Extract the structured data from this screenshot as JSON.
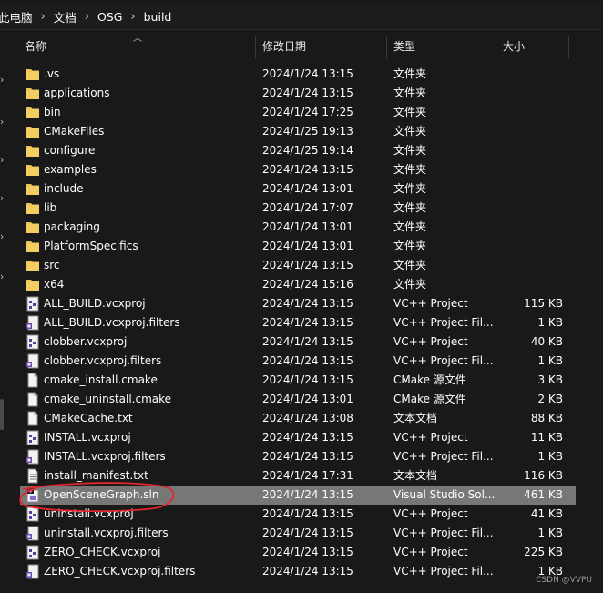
{
  "breadcrumb": {
    "items": [
      "此电脑",
      "文档",
      "OSG",
      "build"
    ],
    "separator": "›"
  },
  "columns": {
    "name": "名称",
    "date": "修改日期",
    "type": "类型",
    "size": "大小"
  },
  "rows": [
    {
      "icon": "folder-icon",
      "name": ".vs",
      "date": "2024/1/24 13:15",
      "type": "文件夹",
      "size": ""
    },
    {
      "icon": "folder-icon",
      "name": "applications",
      "date": "2024/1/24 13:15",
      "type": "文件夹",
      "size": ""
    },
    {
      "icon": "folder-icon",
      "name": "bin",
      "date": "2024/1/24 17:25",
      "type": "文件夹",
      "size": ""
    },
    {
      "icon": "folder-icon",
      "name": "CMakeFiles",
      "date": "2024/1/25 19:13",
      "type": "文件夹",
      "size": ""
    },
    {
      "icon": "folder-icon",
      "name": "configure",
      "date": "2024/1/25 19:14",
      "type": "文件夹",
      "size": ""
    },
    {
      "icon": "folder-icon",
      "name": "examples",
      "date": "2024/1/24 13:15",
      "type": "文件夹",
      "size": ""
    },
    {
      "icon": "folder-icon",
      "name": "include",
      "date": "2024/1/24 13:01",
      "type": "文件夹",
      "size": ""
    },
    {
      "icon": "folder-icon",
      "name": "lib",
      "date": "2024/1/24 17:07",
      "type": "文件夹",
      "size": ""
    },
    {
      "icon": "folder-icon",
      "name": "packaging",
      "date": "2024/1/24 13:01",
      "type": "文件夹",
      "size": ""
    },
    {
      "icon": "folder-icon",
      "name": "PlatformSpecifics",
      "date": "2024/1/24 13:01",
      "type": "文件夹",
      "size": ""
    },
    {
      "icon": "folder-icon",
      "name": "src",
      "date": "2024/1/24 13:15",
      "type": "文件夹",
      "size": ""
    },
    {
      "icon": "folder-icon",
      "name": "x64",
      "date": "2024/1/24 15:16",
      "type": "文件夹",
      "size": ""
    },
    {
      "icon": "vcxproj-icon",
      "name": "ALL_BUILD.vcxproj",
      "date": "2024/1/24 13:15",
      "type": "VC++ Project",
      "size": "115 KB"
    },
    {
      "icon": "vcxproj-filters-icon",
      "name": "ALL_BUILD.vcxproj.filters",
      "date": "2024/1/24 13:15",
      "type": "VC++ Project Fil...",
      "size": "1 KB"
    },
    {
      "icon": "vcxproj-icon",
      "name": "clobber.vcxproj",
      "date": "2024/1/24 13:15",
      "type": "VC++ Project",
      "size": "40 KB"
    },
    {
      "icon": "vcxproj-filters-icon",
      "name": "clobber.vcxproj.filters",
      "date": "2024/1/24 13:15",
      "type": "VC++ Project Fil...",
      "size": "1 KB"
    },
    {
      "icon": "text-file-icon",
      "name": "cmake_install.cmake",
      "date": "2024/1/24 13:15",
      "type": "CMake 源文件",
      "size": "3 KB"
    },
    {
      "icon": "text-file-icon",
      "name": "cmake_uninstall.cmake",
      "date": "2024/1/24 13:01",
      "type": "CMake 源文件",
      "size": "2 KB"
    },
    {
      "icon": "text-file-icon",
      "name": "CMakeCache.txt",
      "date": "2024/1/24 13:08",
      "type": "文本文档",
      "size": "88 KB"
    },
    {
      "icon": "vcxproj-icon",
      "name": "INSTALL.vcxproj",
      "date": "2024/1/24 13:15",
      "type": "VC++ Project",
      "size": "11 KB"
    },
    {
      "icon": "vcxproj-filters-icon",
      "name": "INSTALL.vcxproj.filters",
      "date": "2024/1/24 13:15",
      "type": "VC++ Project Fil...",
      "size": "1 KB"
    },
    {
      "icon": "text-lines-icon",
      "name": "install_manifest.txt",
      "date": "2024/1/24 17:31",
      "type": "文本文档",
      "size": "116 KB"
    },
    {
      "icon": "sln-icon",
      "name": "OpenSceneGraph.sln",
      "date": "2024/1/24 13:15",
      "type": "Visual Studio Sol...",
      "size": "461 KB",
      "selected": true
    },
    {
      "icon": "vcxproj-icon",
      "name": "uninstall.vcxproj",
      "date": "2024/1/24 13:15",
      "type": "VC++ Project",
      "size": "41 KB"
    },
    {
      "icon": "vcxproj-filters-icon",
      "name": "uninstall.vcxproj.filters",
      "date": "2024/1/24 13:15",
      "type": "VC++ Project Fil...",
      "size": "1 KB"
    },
    {
      "icon": "vcxproj-icon",
      "name": "ZERO_CHECK.vcxproj",
      "date": "2024/1/24 13:15",
      "type": "VC++ Project",
      "size": "225 KB"
    },
    {
      "icon": "vcxproj-filters-icon",
      "name": "ZERO_CHECK.vcxproj.filters",
      "date": "2024/1/24 13:15",
      "type": "VC++ Project Fil...",
      "size": "1 KB"
    }
  ],
  "watermark": "CSDN @VVPU",
  "colors": {
    "background": "#191919",
    "selected_row": "#777777",
    "folder": "#e8c35a",
    "annotation": "#e0262f"
  }
}
